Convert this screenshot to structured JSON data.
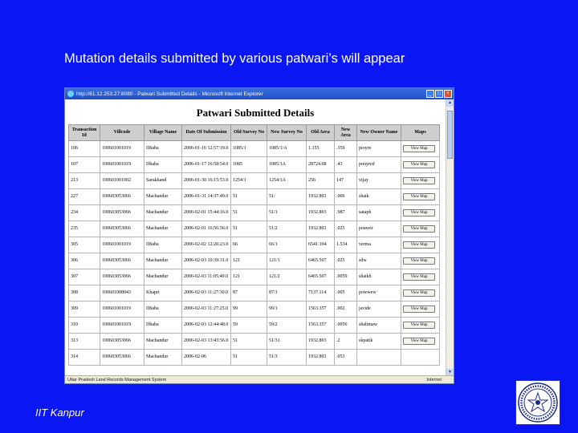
{
  "slide": {
    "title": "Mutation details submitted by  various patwari’s will appear",
    "footer": "IIT Kanpur"
  },
  "browser": {
    "window_title": "http://61.12.253.27:8080 - Patwari Submitted Details - Microsoft Internet Explorer",
    "status_left": "Uttar Pradesh Land Records Management System",
    "status_right": "Internet"
  },
  "page": {
    "heading": "Patwari Submitted Details",
    "columns": [
      "Transaction Id",
      "Villcode",
      "Village Name",
      "Date Of Submission",
      "Old Survey No",
      "New Survey No",
      "Old Area",
      "New Area",
      "New Owner Name",
      "Maps"
    ],
    "button_label": "View Map",
    "rows": [
      [
        "106",
        "100601001019",
        "Dhaba",
        "2006-01-16 12:57:19.0",
        "1085/1",
        "1085/1/A",
        "1.155",
        ".359",
        "pioyre",
        "View Map"
      ],
      [
        "107",
        "100601001019",
        "Dhaba",
        "2006-01-17 16:58:54.0",
        "1085",
        "1085/1A",
        "28724.08",
        ".43",
        "pouyred",
        "View Map"
      ],
      [
        "213",
        "100601001002",
        "Sarakhand",
        "2006-01-30 16:15:53.0",
        "1254/1",
        "1254/1A",
        "256",
        "147",
        "vijay",
        "View Map"
      ],
      [
        "227",
        "100603053066",
        "Machandur",
        "2006-01-31 14:37:49.0",
        "51",
        "51/",
        "1932.803",
        ".006",
        "shaik",
        "View Map"
      ],
      [
        "234",
        "100603053066",
        "Machandur",
        "2006-02-01 15:44:16.0",
        "51",
        "51/1",
        "1932.803",
        ".987",
        "sataph",
        "View Map"
      ],
      [
        "235",
        "100603053066",
        "Machandur",
        "2006-02-01 16:56:56.0",
        "51",
        "51/2",
        "1932.803",
        ".025",
        "poawer",
        "View Map"
      ],
      [
        "305",
        "100601001019",
        "Dhaba",
        "2006-02-02 12:20:23.0",
        "66",
        "66/1",
        "6541.104",
        "1.534",
        "verma",
        "View Map"
      ],
      [
        "306",
        "100603053066",
        "Machandur",
        "2006-02-03 10:39:31.0",
        "121",
        "121/1",
        "6465.507",
        ".025",
        "sdw",
        "View Map"
      ],
      [
        "307",
        "100603053066",
        "Machandur",
        "2006-02-03 11:05:49.0",
        "121",
        "121/2",
        "6465.507",
        ".0059",
        "shaikh",
        "View Map"
      ],
      [
        "308",
        "100601008043",
        "Khapri",
        "2006-02-03 11:27:30.0",
        "87",
        "87/1",
        "7137.114",
        ".005",
        "powwew",
        "View Map"
      ],
      [
        "309",
        "100601001019",
        "Dhaba",
        "2006-02-03 11:27:25.0",
        "99",
        "99/1",
        "1563.357",
        ".002",
        "javide",
        "View Map"
      ],
      [
        "310",
        "100601001019",
        "Dhaba",
        "2006-02-03 12:44:48.0",
        "59",
        "59/2",
        "1563.357",
        ".0056",
        "shalimaw",
        "View Map"
      ],
      [
        "313",
        "100603053066",
        "Machandur",
        "2006-02-03 13:43:56.0",
        "51",
        "51/31",
        "1932.803",
        ".2",
        "skpatik",
        "View Map"
      ],
      [
        "314",
        "100603053066",
        "Machandur",
        "2006-02-06",
        "51",
        "51/3",
        "1932.803",
        ".053",
        "",
        ""
      ]
    ]
  },
  "colors": {
    "slide_background": "#0b16f5",
    "header_background": "#cfcfcf",
    "titlebar": "#1f4fc8"
  },
  "icons": {
    "browser": "ie-icon",
    "logo": "iit-kanpur-seal"
  }
}
